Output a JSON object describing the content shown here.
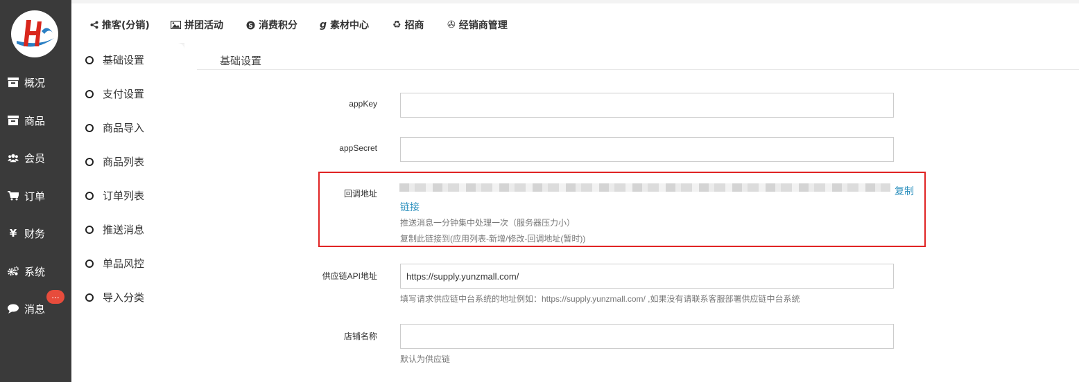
{
  "sidebar": {
    "items": [
      {
        "label": "概况",
        "icon": "archive-icon"
      },
      {
        "label": "商品",
        "icon": "archive-icon"
      },
      {
        "label": "会员",
        "icon": "users-icon"
      },
      {
        "label": "订单",
        "icon": "cart-icon"
      },
      {
        "label": "财务",
        "icon": "yen-icon"
      },
      {
        "label": "系统",
        "icon": "gears-icon"
      },
      {
        "label": "消息",
        "icon": "comment-icon"
      }
    ],
    "message_badge": "..."
  },
  "topnav": {
    "items": [
      {
        "label": "推客(分销)",
        "icon": "share-icon"
      },
      {
        "label": "拼团活动",
        "icon": "image-icon"
      },
      {
        "label": "消费积分",
        "icon": "skype-icon"
      },
      {
        "label": "素材中心",
        "icon": "gittip-icon"
      },
      {
        "label": "招商",
        "icon": "recycle-icon"
      },
      {
        "label": "经销商管理",
        "icon": "vine-icon"
      }
    ]
  },
  "submenu": {
    "items": [
      "基础设置",
      "支付设置",
      "商品导入",
      "商品列表",
      "订单列表",
      "推送消息",
      "单品风控",
      "导入分类"
    ]
  },
  "main": {
    "section_title": "基础设置",
    "fields": {
      "appkey_label": "appKey",
      "appsecret_label": "appSecret",
      "callback_label": "回调地址",
      "callback_copy": "复制",
      "callback_link": "链接",
      "callback_help1": "推送消息一分钟集中处理一次（服务器压力小）",
      "callback_help2": "复制此链接到(应用列表-新增/修改-回调地址(暂时))",
      "api_label": "供应链API地址",
      "api_value": "https://supply.yunzmall.com/",
      "api_help": "填写请求供应链中台系统的地址例如：https://supply.yunzmall.com/ ,如果没有请联系客服部署供应链中台系统",
      "shop_label": "店铺名称",
      "shop_help": "默认为供应链"
    }
  },
  "colors": {
    "sidebar_bg": "#3a3a3a",
    "badge": "#e74c3c",
    "highlight_border": "#e02424",
    "link": "#2a8fbd"
  }
}
